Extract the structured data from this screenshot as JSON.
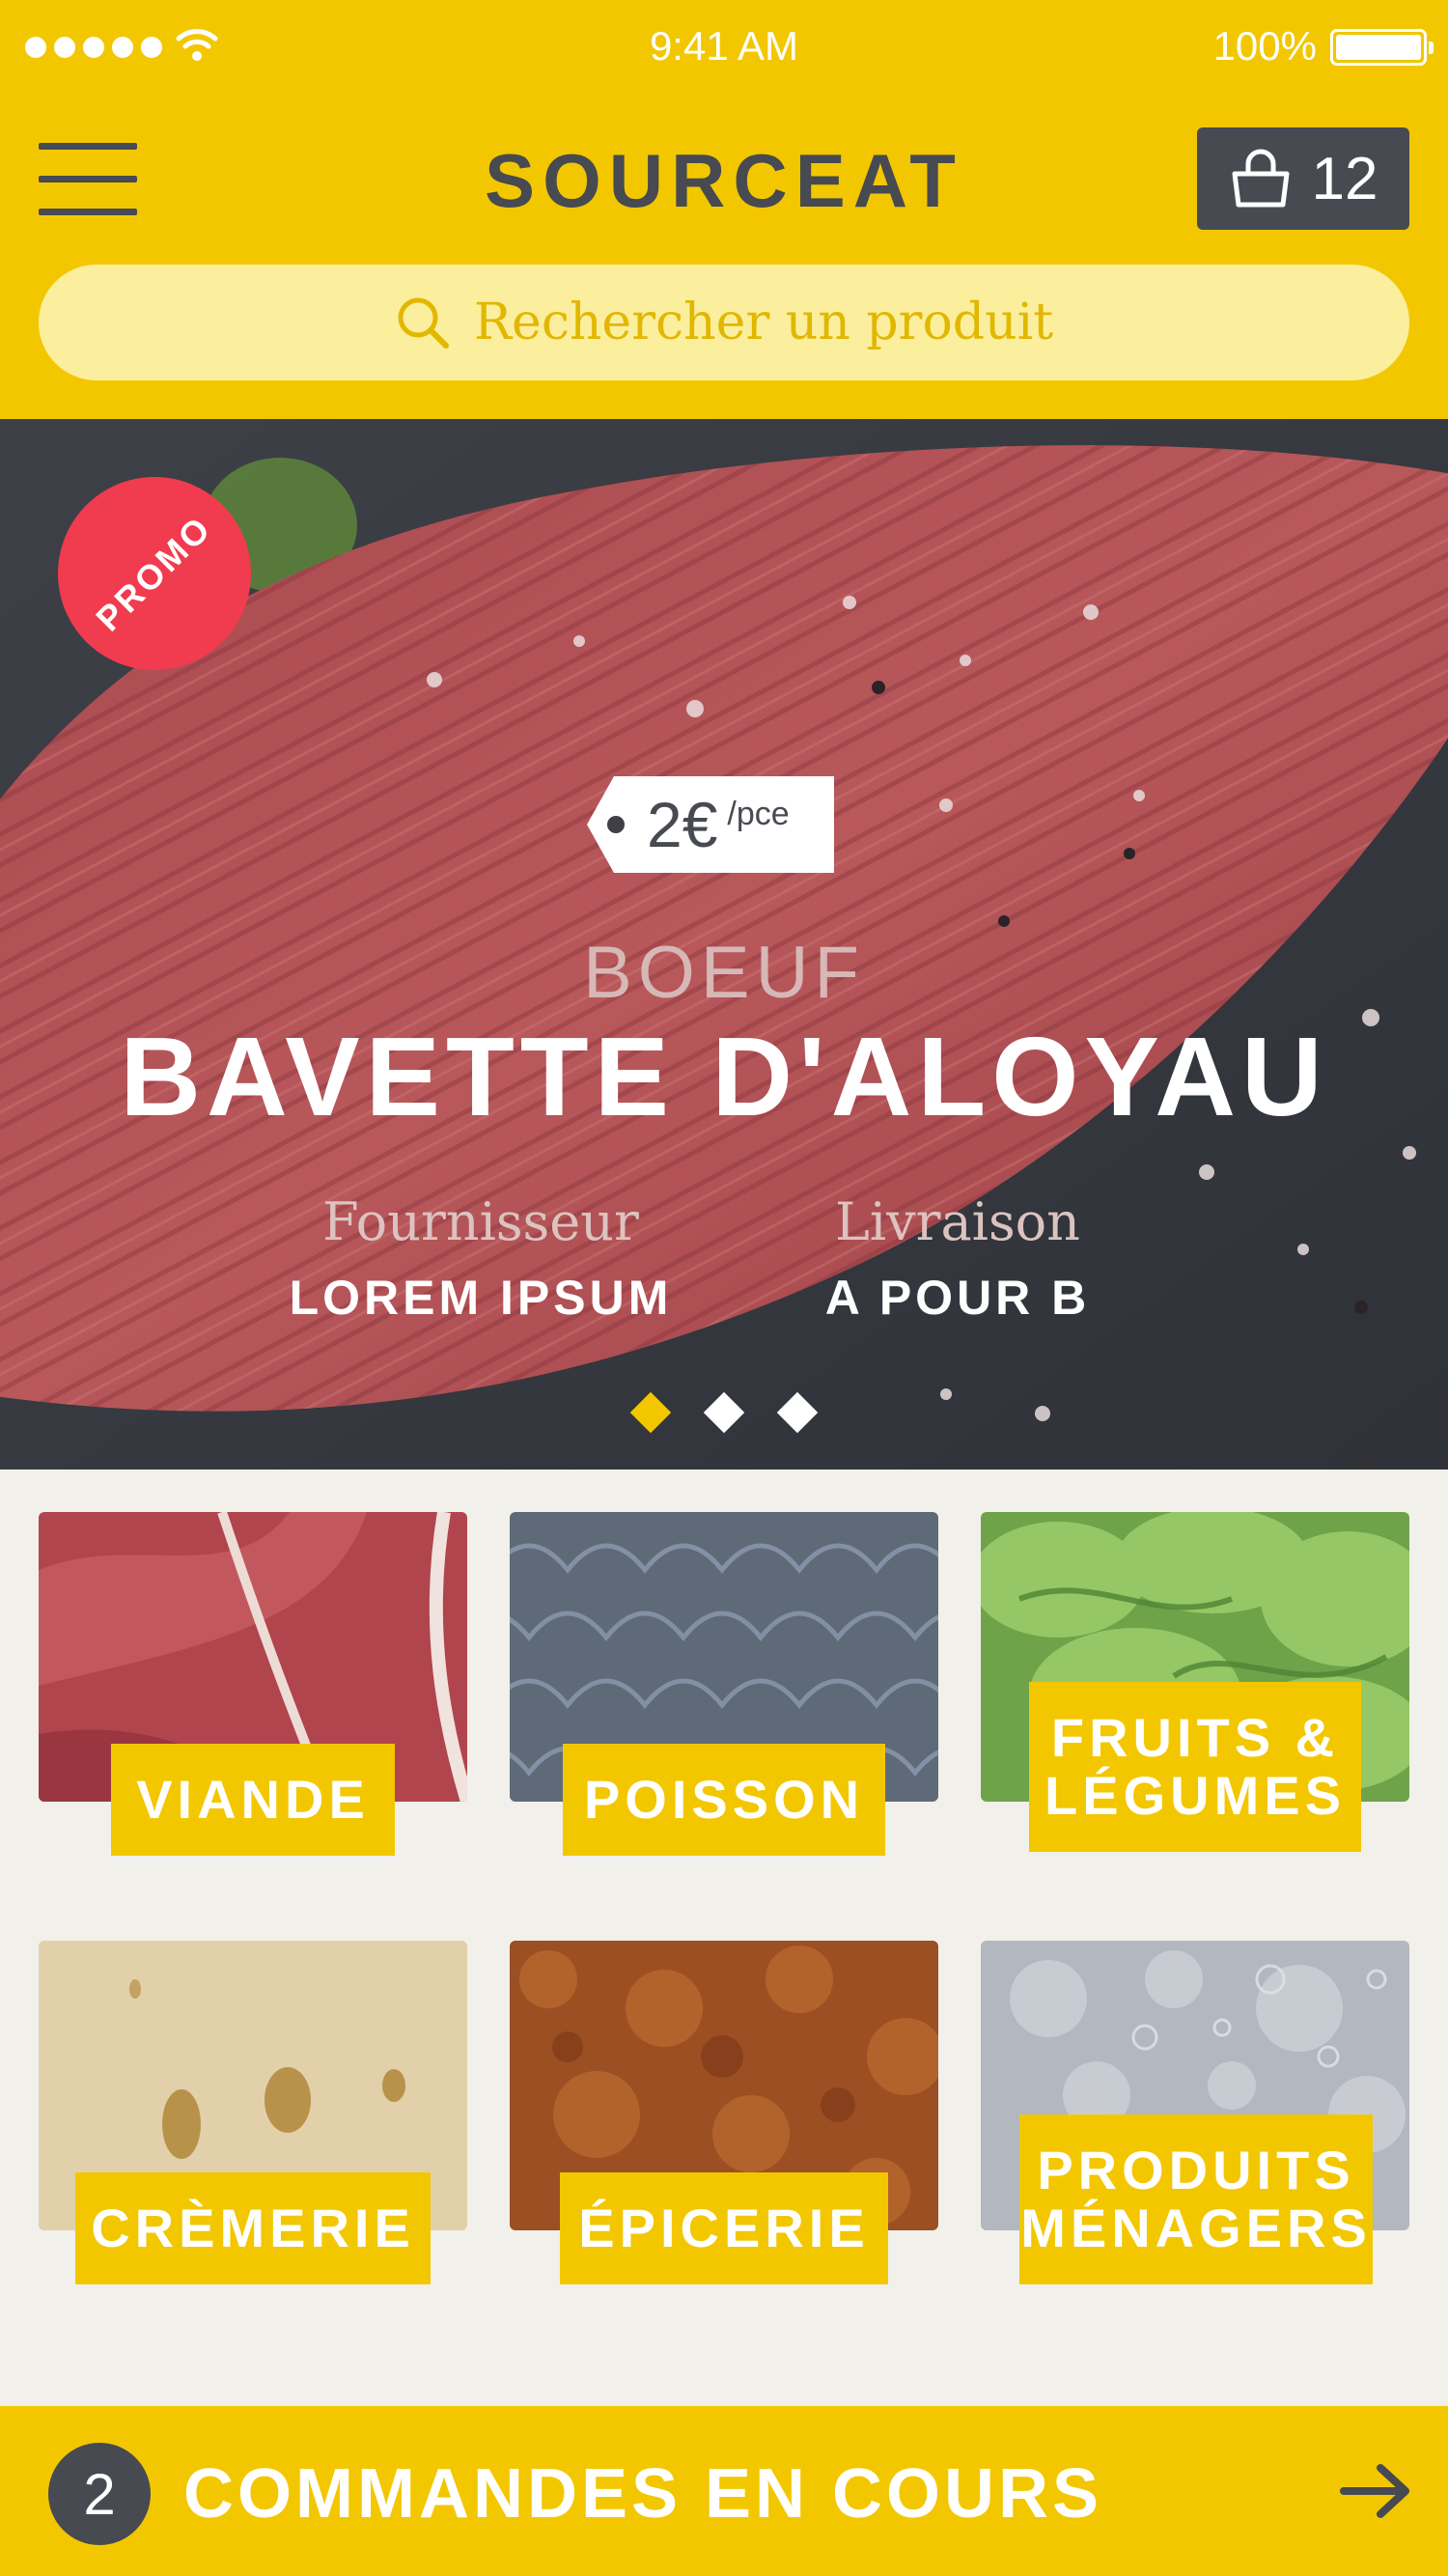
{
  "status_bar": {
    "time": "9:41 AM",
    "battery": "100%"
  },
  "header": {
    "brand": "SOURCEAT",
    "cart_count": "12",
    "search_placeholder": "Rechercher un produit"
  },
  "hero": {
    "badge": "PROMO",
    "price": "2€",
    "price_unit": "/pce",
    "category": "BOEUF",
    "title": "BAVETTE D'ALOYAU",
    "supplier_label": "Fournisseur",
    "supplier_value": "LOREM IPSUM",
    "delivery_label": "Livraison",
    "delivery_value": "A POUR B",
    "slide_count": 3,
    "active_slide": 1
  },
  "categories": [
    {
      "label_lines": [
        "VIANDE"
      ],
      "image": "meat"
    },
    {
      "label_lines": [
        "POISSON"
      ],
      "image": "fish-scales"
    },
    {
      "label_lines": [
        "FRUITS &",
        "LÉGUMES"
      ],
      "image": "lettuce"
    },
    {
      "label_lines": [
        "CRÈMERIE"
      ],
      "image": "cheese"
    },
    {
      "label_lines": [
        "ÉPICERIE"
      ],
      "image": "spices"
    },
    {
      "label_lines": [
        "PRODUITS",
        "MÉNAGERS"
      ],
      "image": "foam"
    }
  ],
  "bottom_bar": {
    "count": "2",
    "label": "COMMANDES EN COURS"
  },
  "colors": {
    "accent_yellow": "#f3c700",
    "dark_slate": "#474a51",
    "promo_red": "#f13b4f",
    "background": "#f2f0ea"
  }
}
